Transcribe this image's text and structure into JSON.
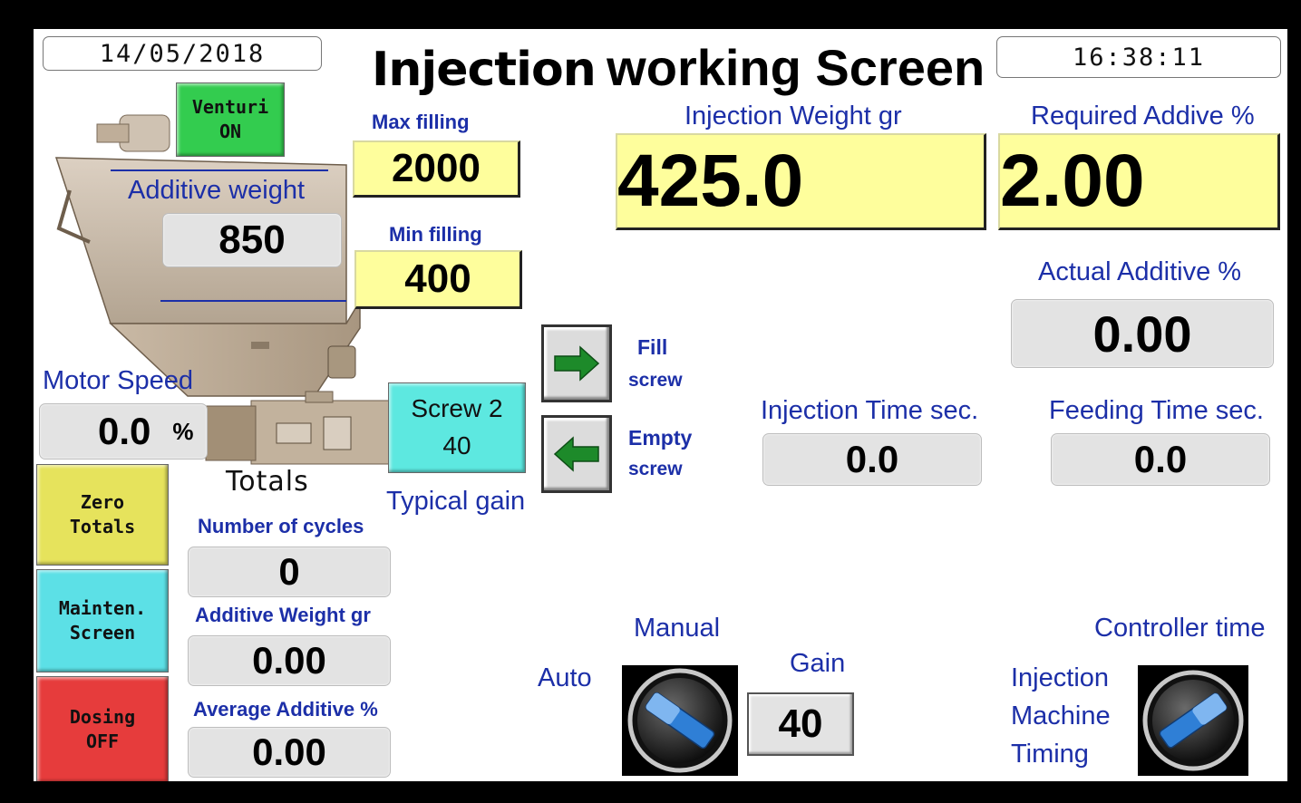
{
  "header": {
    "date": "14/05/2018",
    "time": "16:38:11",
    "title_part1": "Injection",
    "title_part2": "working Screen"
  },
  "hopper": {
    "venturi_button": {
      "line1": "Venturi",
      "line2": "ON",
      "color": "#33cc4f"
    },
    "max_filling_label": "Max filling",
    "max_filling_value": "2000",
    "min_filling_label": "Min filling",
    "min_filling_value": "400",
    "additive_weight_label": "Additive weight",
    "additive_weight_value": "850"
  },
  "motor": {
    "label": "Motor Speed",
    "value": "0.0",
    "unit": "%"
  },
  "screw": {
    "button_line1": "Screw 2",
    "button_line2": "40",
    "button_color": "#5de8e0",
    "typical_gain_label": "Typical gain",
    "fill_label_1": "Fill",
    "fill_label_2": "screw",
    "empty_label_1": "Empty",
    "empty_label_2": "screw"
  },
  "left_buttons": {
    "zero_totals": {
      "line1": "Zero",
      "line2": "Totals",
      "color": "#e6e35c"
    },
    "mainten_screen": {
      "line1": "Mainten.",
      "line2": "Screen",
      "color": "#5ce0e6"
    },
    "dosing": {
      "line1": "Dosing",
      "line2": "OFF",
      "color": "#e63c3c"
    }
  },
  "totals": {
    "title": "Totals",
    "cycles_label": "Number of cycles",
    "cycles_value": "0",
    "additive_weight_label": "Additive Weight gr",
    "additive_weight_value": "0.00",
    "average_label": "Average Additive %",
    "average_value": "0.00"
  },
  "injection": {
    "weight_label": "Injection Weight gr",
    "weight_value": "425.0",
    "required_label": "Required Addive %",
    "required_value": "2.00",
    "actual_label": "Actual Additive %",
    "actual_value": "0.00",
    "inj_time_label": "Injection Time sec.",
    "inj_time_value": "0.0",
    "feed_time_label": "Feeding Time sec.",
    "feed_time_value": "0.0"
  },
  "mode": {
    "manual_label": "Manual",
    "auto_label": "Auto",
    "gain_label": "Gain",
    "gain_value": "40",
    "controller_time_label": "Controller time",
    "injection_label": "Injection",
    "machine_label": "Machine",
    "timing_label": "Timing"
  },
  "colors": {
    "label_blue": "#1c2fa8",
    "field_yellow": "#fefe9c",
    "field_gray": "#e3e3e3",
    "arrow_green": "#1d8a2a",
    "knob_blue": "#2f7fd6"
  }
}
